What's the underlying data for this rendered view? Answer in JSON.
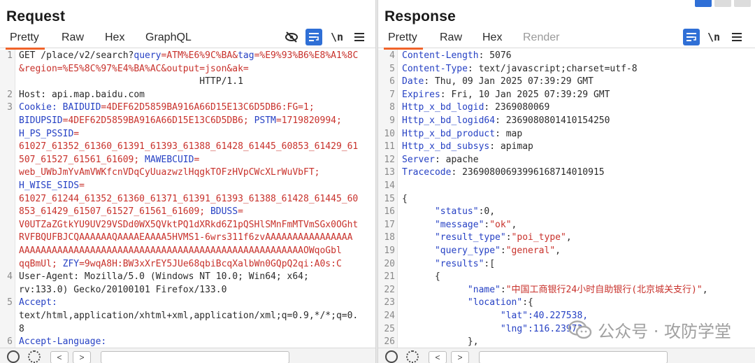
{
  "request": {
    "title": "Request",
    "tabs": [
      "Pretty",
      "Raw",
      "Hex",
      "GraphQL"
    ],
    "active_tab": "Pretty",
    "tool_newline": "\\n",
    "lines": [
      {
        "n": "1",
        "segs": [
          {
            "t": "GET /place/v2/search?",
            "c": "dark"
          },
          {
            "t": "query",
            "c": "blue"
          },
          {
            "t": "=ATM%E6%9C%BA&",
            "c": "red"
          },
          {
            "t": "tag",
            "c": "blue"
          },
          {
            "t": "=%E9%93%B6%E8%A1%8C",
            "c": "red"
          }
        ]
      },
      {
        "n": "",
        "segs": [
          {
            "t": "&region=%E5%8C%97%E4%BA%AC&output=json&ak=",
            "c": "red"
          }
        ]
      },
      {
        "n": "",
        "segs": [
          {
            "t": "                                 HTTP/1.1",
            "c": "dark"
          }
        ]
      },
      {
        "n": "2",
        "segs": [
          {
            "t": "Host: api.map.baidu.com",
            "c": "dark"
          }
        ]
      },
      {
        "n": "3",
        "segs": [
          {
            "t": "Cookie: ",
            "c": "blue"
          },
          {
            "t": "BAIDUID",
            "c": "blue"
          },
          {
            "t": "=4DEF62D5859BA916A66D15E13C6D5DB6:FG=1;",
            "c": "red"
          }
        ]
      },
      {
        "n": "",
        "segs": [
          {
            "t": "BIDUPSID",
            "c": "blue"
          },
          {
            "t": "=4DEF62D5859BA916A66D15E13C6D5DB6; ",
            "c": "red"
          },
          {
            "t": "PSTM",
            "c": "blue"
          },
          {
            "t": "=1719820994;",
            "c": "red"
          }
        ]
      },
      {
        "n": "",
        "segs": [
          {
            "t": "H_PS_PSSID",
            "c": "blue"
          },
          {
            "t": "=",
            "c": "red"
          }
        ]
      },
      {
        "n": "",
        "segs": [
          {
            "t": "61027_61352_61360_61391_61393_61388_61428_61445_60853_61429_61",
            "c": "red"
          }
        ]
      },
      {
        "n": "",
        "segs": [
          {
            "t": "507_61527_61561_61609; ",
            "c": "red"
          },
          {
            "t": "MAWEBCUID",
            "c": "blue"
          },
          {
            "t": "=",
            "c": "red"
          }
        ]
      },
      {
        "n": "",
        "segs": [
          {
            "t": "web_UWbJmYvAmVWKfcnVDqCyUuazwzlHqgkTOFzHVpCWcXLrWuVbFT;",
            "c": "red"
          }
        ]
      },
      {
        "n": "",
        "segs": [
          {
            "t": "H_WISE_SIDS",
            "c": "blue"
          },
          {
            "t": "=",
            "c": "red"
          }
        ]
      },
      {
        "n": "",
        "segs": [
          {
            "t": "61027_61244_61352_61360_61371_61391_61393_61388_61428_61445_60",
            "c": "red"
          }
        ]
      },
      {
        "n": "",
        "segs": [
          {
            "t": "853_61429_61507_61527_61561_61609; ",
            "c": "red"
          },
          {
            "t": "BDUSS",
            "c": "blue"
          },
          {
            "t": "=",
            "c": "red"
          }
        ]
      },
      {
        "n": "",
        "segs": [
          {
            "t": "V0UTZaZGtkYU9UV29VSDd0WX5QVktPQ1dXRkd6Z1pQSHlSMnFmMTVmSGx0OGht",
            "c": "red"
          }
        ]
      },
      {
        "n": "",
        "segs": [
          {
            "t": "RVFBQUFBJCQAAAAAAQAAAAEAAAA5HVMS1-6wrs311f6zvAAAAAAAAAAAAAAAA",
            "c": "red"
          }
        ]
      },
      {
        "n": "",
        "segs": [
          {
            "t": "AAAAAAAAAAAAAAAAAAAAAAAAAAAAAAAAAAAAAAAAAAAAAAAAAAAAOWqoGbl",
            "c": "red"
          }
        ]
      },
      {
        "n": "",
        "segs": [
          {
            "t": "qqBmUl; ",
            "c": "red"
          },
          {
            "t": "ZFY",
            "c": "blue"
          },
          {
            "t": "=9wqA8H:BW3xXrEY5JUe68qbiBcqXalbWn0GQpQ2qi:A0s:C",
            "c": "red"
          }
        ]
      },
      {
        "n": "4",
        "segs": [
          {
            "t": "User-Agent: Mozilla/5.0 (Windows NT 10.0; Win64; x64;",
            "c": "dark"
          }
        ]
      },
      {
        "n": "",
        "segs": [
          {
            "t": "rv:133.0) Gecko/20100101 Firefox/133.0",
            "c": "dark"
          }
        ]
      },
      {
        "n": "5",
        "segs": [
          {
            "t": "Accept:",
            "c": "blue"
          }
        ]
      },
      {
        "n": "",
        "segs": [
          {
            "t": "text/html,application/xhtml+xml,application/xml;q=0.9,*/*;q=0.",
            "c": "dark"
          }
        ]
      },
      {
        "n": "",
        "segs": [
          {
            "t": "8",
            "c": "dark"
          }
        ]
      },
      {
        "n": "6",
        "segs": [
          {
            "t": "Accept-Language:",
            "c": "blue"
          }
        ]
      }
    ]
  },
  "response": {
    "title": "Response",
    "tabs": [
      "Pretty",
      "Raw",
      "Hex",
      "Render"
    ],
    "active_tab": "Pretty",
    "tool_newline": "\\n",
    "lines": [
      {
        "n": "4",
        "segs": [
          {
            "t": "Content-Length",
            "c": "blue"
          },
          {
            "t": ": 5076",
            "c": "dark"
          }
        ]
      },
      {
        "n": "5",
        "segs": [
          {
            "t": "Content-Type",
            "c": "blue"
          },
          {
            "t": ": text/javascript;charset=utf-8",
            "c": "dark"
          }
        ]
      },
      {
        "n": "6",
        "segs": [
          {
            "t": "Date",
            "c": "blue"
          },
          {
            "t": ": Thu, 09 Jan 2025 07:39:29 GMT",
            "c": "dark"
          }
        ]
      },
      {
        "n": "7",
        "segs": [
          {
            "t": "Expires",
            "c": "blue"
          },
          {
            "t": ": Fri, 10 Jan 2025 07:39:29 GMT",
            "c": "dark"
          }
        ]
      },
      {
        "n": "8",
        "segs": [
          {
            "t": "Http_x_bd_logid",
            "c": "blue"
          },
          {
            "t": ": 2369080069",
            "c": "dark"
          }
        ]
      },
      {
        "n": "9",
        "segs": [
          {
            "t": "Http_x_bd_logid64",
            "c": "blue"
          },
          {
            "t": ": 2369080801410154250",
            "c": "dark"
          }
        ]
      },
      {
        "n": "10",
        "segs": [
          {
            "t": "Http_x_bd_product",
            "c": "blue"
          },
          {
            "t": ": map",
            "c": "dark"
          }
        ]
      },
      {
        "n": "11",
        "segs": [
          {
            "t": "Http_x_bd_subsys",
            "c": "blue"
          },
          {
            "t": ": apimap",
            "c": "dark"
          }
        ]
      },
      {
        "n": "12",
        "segs": [
          {
            "t": "Server",
            "c": "blue"
          },
          {
            "t": ": apache",
            "c": "dark"
          }
        ]
      },
      {
        "n": "13",
        "segs": [
          {
            "t": "Tracecode",
            "c": "blue"
          },
          {
            "t": ": 23690800693996168714010915",
            "c": "dark"
          }
        ]
      },
      {
        "n": "14",
        "segs": [
          {
            "t": "",
            "c": "dark"
          }
        ]
      },
      {
        "n": "15",
        "segs": [
          {
            "t": "{",
            "c": "dark"
          }
        ]
      },
      {
        "n": "16",
        "segs": [
          {
            "t": "      \"status\"",
            "c": "blue"
          },
          {
            "t": ":0,",
            "c": "dark"
          }
        ]
      },
      {
        "n": "17",
        "segs": [
          {
            "t": "      \"message\"",
            "c": "blue"
          },
          {
            "t": ":",
            "c": "dark"
          },
          {
            "t": "\"ok\"",
            "c": "red"
          },
          {
            "t": ",",
            "c": "dark"
          }
        ]
      },
      {
        "n": "18",
        "segs": [
          {
            "t": "      \"result_type\"",
            "c": "blue"
          },
          {
            "t": ":",
            "c": "dark"
          },
          {
            "t": "\"poi_type\"",
            "c": "red"
          },
          {
            "t": ",",
            "c": "dark"
          }
        ]
      },
      {
        "n": "19",
        "segs": [
          {
            "t": "      \"query_type\"",
            "c": "blue"
          },
          {
            "t": ":",
            "c": "dark"
          },
          {
            "t": "\"general\"",
            "c": "red"
          },
          {
            "t": ",",
            "c": "dark"
          }
        ]
      },
      {
        "n": "20",
        "segs": [
          {
            "t": "      \"results\"",
            "c": "blue"
          },
          {
            "t": ":[",
            "c": "dark"
          }
        ]
      },
      {
        "n": "21",
        "segs": [
          {
            "t": "      {",
            "c": "dark"
          }
        ]
      },
      {
        "n": "22",
        "segs": [
          {
            "t": "            \"name\"",
            "c": "blue"
          },
          {
            "t": ":",
            "c": "dark"
          },
          {
            "t": "\"中国工商银行24小时自助银行(北京城关支行)\"",
            "c": "red"
          },
          {
            "t": ",",
            "c": "dark"
          }
        ]
      },
      {
        "n": "23",
        "segs": [
          {
            "t": "            \"location\"",
            "c": "blue"
          },
          {
            "t": ":{",
            "c": "dark"
          }
        ]
      },
      {
        "n": "24",
        "segs": [
          {
            "t": "                  \"lat\"",
            "c": "blue"
          },
          {
            "t": ":40.227538,",
            "c": "blue"
          }
        ]
      },
      {
        "n": "25",
        "segs": [
          {
            "t": "                  \"lng\"",
            "c": "blue"
          },
          {
            "t": ":116.23973",
            "c": "blue"
          }
        ]
      },
      {
        "n": "26",
        "segs": [
          {
            "t": "            },",
            "c": "dark"
          }
        ]
      }
    ]
  },
  "watermark": {
    "text": "公众号 · 攻防学堂"
  }
}
